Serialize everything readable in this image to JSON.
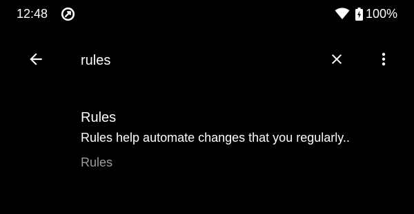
{
  "status_bar": {
    "time": "12:48",
    "battery": "100%",
    "icons": [
      "app-notification-icon",
      "wifi-icon",
      "battery-charging-icon"
    ]
  },
  "toolbar": {
    "back_icon": "arrow-back-icon",
    "search_value": "rules",
    "clear_icon": "close-icon",
    "more_icon": "more-vert-icon"
  },
  "results": [
    {
      "title": "Rules",
      "summary": "Rules help automate changes that you regularly..",
      "breadcrumb": "Rules"
    }
  ],
  "colors": {
    "background": "#000000",
    "text_primary": "#ffffff",
    "text_secondary": "#9e9e9e"
  }
}
